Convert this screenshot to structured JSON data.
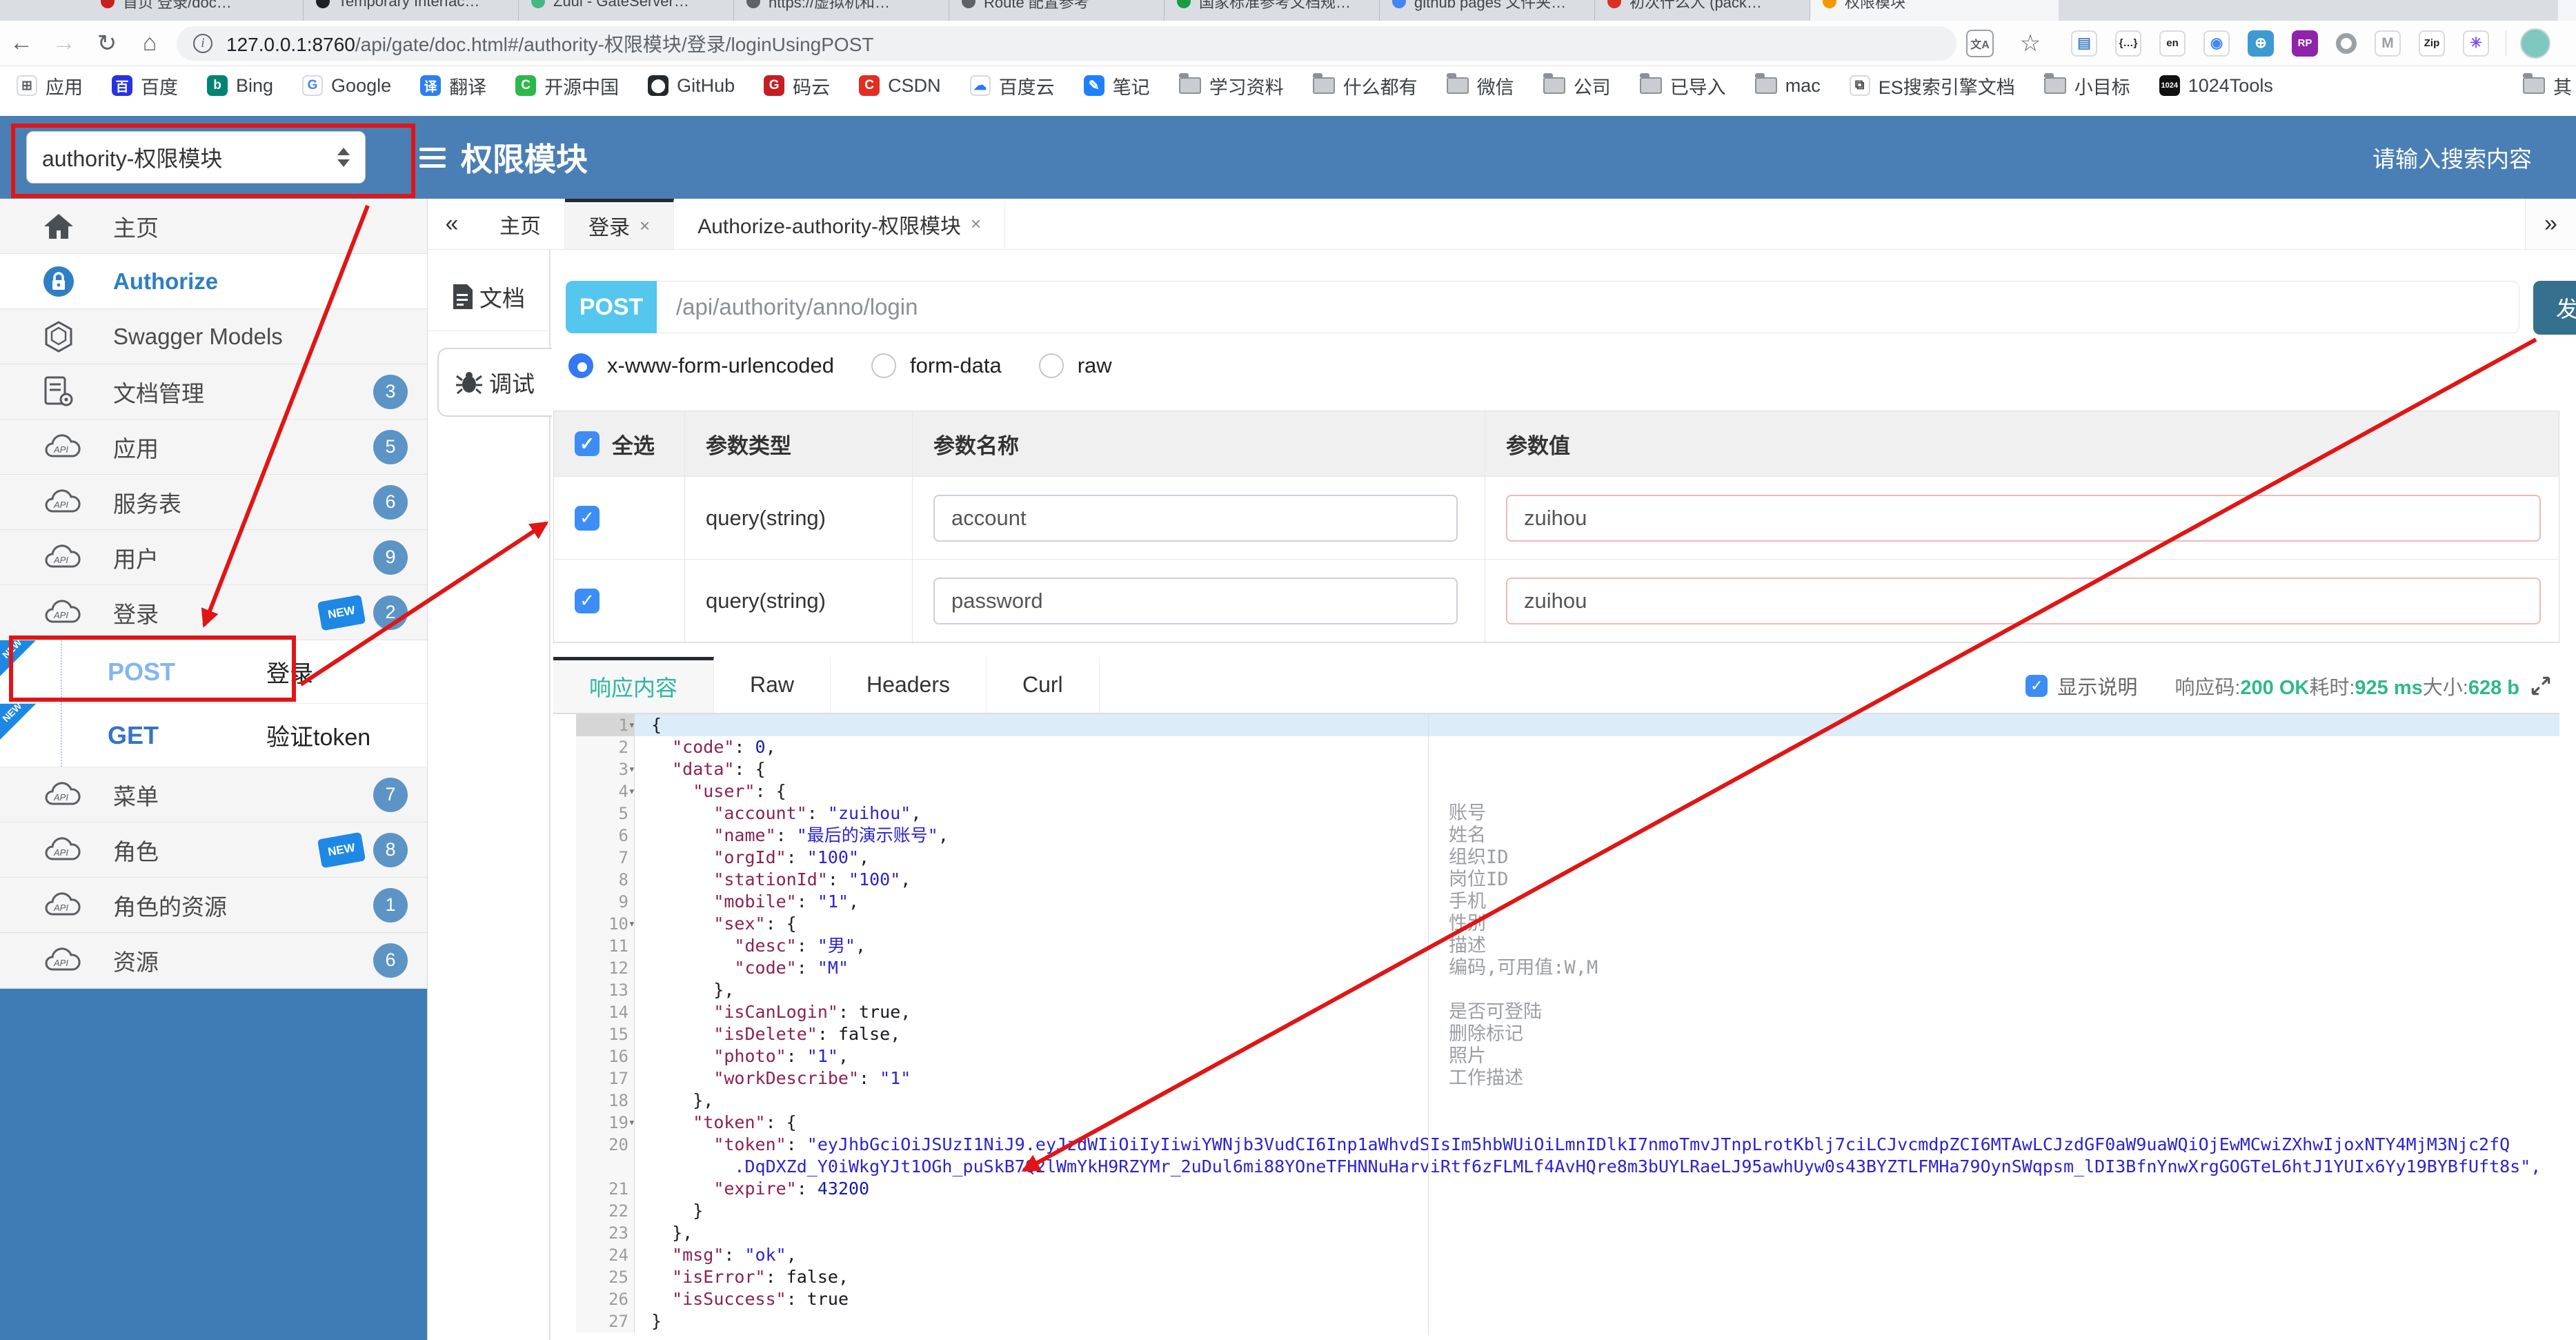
{
  "browser": {
    "tabs": [
      {
        "label": "首页 登录/doc…",
        "color": "#c5221f"
      },
      {
        "label": "Temporary Interfac…",
        "color": "#202124"
      },
      {
        "label": "Zuul - GateServer…",
        "color": "#42b983"
      },
      {
        "label": "https://虚拟机和…",
        "color": "#5f6368"
      },
      {
        "label": "Route 配置参考",
        "color": "#5f6368"
      },
      {
        "label": "国家标准参考文档规…",
        "color": "#1a9c46"
      },
      {
        "label": "github pages 文件夹…",
        "color": "#4285f4"
      },
      {
        "label": "初次什么人 (pack…",
        "color": "#d93025"
      },
      {
        "label": "权限模块",
        "color": "#f29900",
        "active": true
      }
    ],
    "toolbar": {
      "url_host": "127.0.0.1:8760",
      "url_path": "/api/gate/doc.html#/authority-权限模块/登录/loginUsingPOST",
      "extensions": [
        "doc-ext",
        "json-viewer-ext",
        "translate-en-ext",
        "chrome-ext",
        "globe-ext",
        "rp-ext",
        "octotree-ext",
        "tampermonkey-ext",
        "gitzip-ext",
        "oss-ext"
      ]
    },
    "bookmarks": [
      {
        "icon": "apps",
        "label": "应用"
      },
      {
        "icon": "baidu",
        "label": "百度"
      },
      {
        "icon": "bing",
        "label": "Bing"
      },
      {
        "icon": "google",
        "label": "Google"
      },
      {
        "icon": "trans",
        "label": "翻译"
      },
      {
        "icon": "osc",
        "label": "开源中国"
      },
      {
        "icon": "github",
        "label": "GitHub"
      },
      {
        "icon": "gitee",
        "label": "码云"
      },
      {
        "icon": "csdn",
        "label": "CSDN"
      },
      {
        "icon": "bdy",
        "label": "百度云"
      },
      {
        "icon": "note",
        "label": "笔记"
      },
      {
        "icon": "folder",
        "label": "学习资料"
      },
      {
        "icon": "folder",
        "label": "什么都有"
      },
      {
        "icon": "folder",
        "label": "微信"
      },
      {
        "icon": "folder",
        "label": "公司"
      },
      {
        "icon": "folder",
        "label": "已导入"
      },
      {
        "icon": "folder",
        "label": "mac"
      },
      {
        "icon": "book",
        "label": "ES搜索引擎文档"
      },
      {
        "icon": "folder",
        "label": "小目标"
      },
      {
        "icon": "t1024",
        "label": "1024Tools"
      }
    ],
    "bookmarks_overflow": "其"
  },
  "header": {
    "service_select": "authority-权限模块",
    "title": "权限模块",
    "search_placeholder": "请输入搜索内容"
  },
  "sidebar": {
    "items": [
      {
        "icon": "home",
        "label": "主页"
      },
      {
        "icon": "lock",
        "label": "Authorize",
        "active": true
      },
      {
        "icon": "models",
        "label": "Swagger Models"
      },
      {
        "icon": "docgear",
        "label": "文档管理",
        "badge": "3"
      },
      {
        "icon": "api",
        "label": "应用",
        "badge": "5"
      },
      {
        "icon": "api",
        "label": "服务表",
        "badge": "6"
      },
      {
        "icon": "api",
        "label": "用户",
        "badge": "9"
      },
      {
        "icon": "api",
        "label": "登录",
        "badge": "2",
        "isNew": true
      },
      {
        "method": "POST",
        "label": "登录",
        "isNew": true
      },
      {
        "method": "GET",
        "label": "验证token",
        "isNew": true
      },
      {
        "icon": "api",
        "label": "菜单",
        "badge": "7"
      },
      {
        "icon": "api",
        "label": "角色",
        "badge": "8",
        "isNew": true
      },
      {
        "icon": "api",
        "label": "角色的资源",
        "badge": "1"
      },
      {
        "icon": "api",
        "label": "资源",
        "badge": "6"
      }
    ]
  },
  "doc_tabs": {
    "collapse": "«",
    "expand": "»",
    "tabs": [
      {
        "label": "主页"
      },
      {
        "label": "登录",
        "closable": true,
        "active": true
      },
      {
        "label": "Authorize-authority-权限模块",
        "closable": true
      }
    ]
  },
  "rail": {
    "doc": "文档",
    "debug": "调试"
  },
  "request": {
    "method": "POST",
    "path": "/api/authority/anno/login",
    "send_label": "发送",
    "body_types": [
      "x-www-form-urlencoded",
      "form-data",
      "raw"
    ],
    "selected_body_type": "x-www-form-urlencoded",
    "table": {
      "headers": {
        "all": "全选",
        "type": "参数类型",
        "name": "参数名称",
        "value": "参数值"
      },
      "rows": [
        {
          "checked": true,
          "type": "query(string)",
          "name": "account",
          "value": "zuihou"
        },
        {
          "checked": true,
          "type": "query(string)",
          "name": "password",
          "value": "zuihou"
        }
      ]
    }
  },
  "response": {
    "tabs": [
      "响应内容",
      "Raw",
      "Headers",
      "Curl"
    ],
    "active_tab": "响应内容",
    "show_desc_label": "显示说明",
    "status": [
      {
        "label": "响应码:",
        "value": "200 OK"
      },
      {
        "label": "耗时:",
        "value": "925 ms"
      },
      {
        "label": "大小:",
        "value": "628 b"
      }
    ],
    "json_lines": [
      {
        "n": 1,
        "text": "{",
        "fold": true,
        "active": true
      },
      {
        "n": 2,
        "text": "  \"code\": 0,"
      },
      {
        "n": 3,
        "text": "  \"data\": {",
        "fold": true
      },
      {
        "n": 4,
        "text": "    \"user\": {",
        "fold": true
      },
      {
        "n": 5,
        "text": "      \"account\": \"zuihou\","
      },
      {
        "n": 6,
        "text": "      \"name\": \"最后的演示账号\","
      },
      {
        "n": 7,
        "text": "      \"orgId\": \"100\","
      },
      {
        "n": 8,
        "text": "      \"stationId\": \"100\","
      },
      {
        "n": 9,
        "text": "      \"mobile\": \"1\","
      },
      {
        "n": 10,
        "text": "      \"sex\": {",
        "fold": true
      },
      {
        "n": 11,
        "text": "        \"desc\": \"男\","
      },
      {
        "n": 12,
        "text": "        \"code\": \"M\""
      },
      {
        "n": 13,
        "text": "      },"
      },
      {
        "n": 14,
        "text": "      \"isCanLogin\": true,"
      },
      {
        "n": 15,
        "text": "      \"isDelete\": false,"
      },
      {
        "n": 16,
        "text": "      \"photo\": \"1\","
      },
      {
        "n": 17,
        "text": "      \"workDescribe\": \"1\""
      },
      {
        "n": 18,
        "text": "    },"
      },
      {
        "n": 19,
        "text": "    \"token\": {",
        "fold": true
      },
      {
        "n": 20,
        "text": "      \"token\": \"eyJhbGciOiJSUzI1NiJ9.eyJzdWIiOiIyIiwiYWNjb3VudCI6Inp1aWhvdSIsIm5hbWUiOiLmnIDlkI7nmoTmvJTnpLrotKblj7ciLCJvcmdpZCI6MTAwLCJzdGF0aW9uaWQiOjEwMCwiZXhwIjoxNTY4MjM3Njc2fQ",
        "wrap": "        .DqDXZd_Y0iWkgYJt1OGh_puSkB7Q2lWmYkH9RZYMr_2uDul6mi88YOneTFHNNuHarviRtf6zFLMLf4AvHQre8m3bUYLRaeLJ95awhUyw0s43BYZTLFMHa79OynSWqpsm_lDI3BfnYnwXrgGOGTeL6htJ1YUIx6Yy19BYBfUft8s\","
      },
      {
        "n": 21,
        "text": "      \"expire\": 43200"
      },
      {
        "n": 22,
        "text": "    }"
      },
      {
        "n": 23,
        "text": "  },"
      },
      {
        "n": 24,
        "text": "  \"msg\": \"ok\","
      },
      {
        "n": 25,
        "text": "  \"isError\": false,"
      },
      {
        "n": 26,
        "text": "  \"isSuccess\": true"
      },
      {
        "n": 27,
        "text": "}"
      }
    ],
    "annotations": {
      "5": "账号",
      "6": "姓名",
      "7": "组织ID",
      "8": "岗位ID",
      "9": "手机",
      "10": "性别",
      "11": "描述",
      "12": "编码,可用值:W,M",
      "14": "是否可登陆",
      "15": "删除标记",
      "16": "照片",
      "17": "工作描述"
    }
  },
  "colors": {
    "header_blue": "#4a7fb5",
    "post_chip": "#55c6ed",
    "send_button": "#35708e",
    "status_green": "#2eb98a",
    "annotation_red": "#e11515"
  }
}
